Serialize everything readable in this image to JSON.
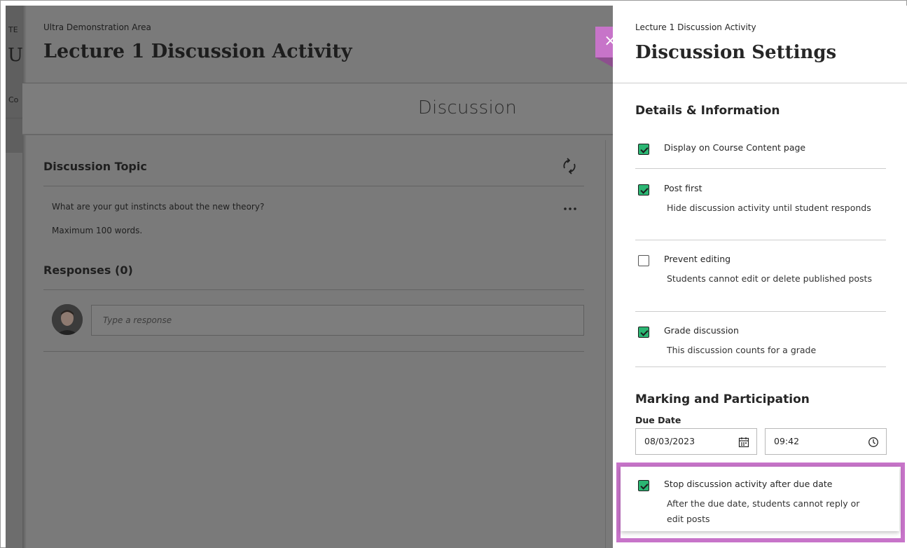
{
  "underlying_page": {
    "fragment_1": "TE",
    "fragment_2": "U",
    "fragment_3": "Co"
  },
  "background_panel": {
    "breadcrumb": "Ultra Demonstration Area",
    "title": "Lecture 1 Discussion Activity",
    "tab_label": "Discussion",
    "topic_heading": "Discussion Topic",
    "topic_question": "What are your gut instincts about the new theory?",
    "topic_note": "Maximum 100 words.",
    "responses_heading": "Responses (0)",
    "response_placeholder": "Type a response"
  },
  "close_button": {
    "glyph": "×"
  },
  "settings_panel": {
    "breadcrumb": "Lecture 1 Discussion Activity",
    "title": "Discussion Settings",
    "details_heading": "Details & Information",
    "settings": [
      {
        "label": "Display on Course Content page",
        "description": "",
        "checked": true
      },
      {
        "label": "Post first",
        "description": "Hide discussion activity until student responds",
        "checked": true
      },
      {
        "label": "Prevent editing",
        "description": "Students cannot edit or delete published posts",
        "checked": false
      },
      {
        "label": "Grade discussion",
        "description": "This discussion counts for a grade",
        "checked": true
      }
    ],
    "marking_heading": "Marking and Participation",
    "due_date_label": "Due Date",
    "due_date_value": "08/03/2023",
    "due_time_value": "09:42",
    "stop_activity": {
      "label": "Stop discussion activity after due date",
      "description": "After the due date, students cannot reply or edit posts",
      "checked": true
    }
  },
  "colors": {
    "accent_purple": "#c774c9",
    "checkbox_green": "#2bb673",
    "overlay_gray": "#7a7a7a"
  },
  "icons": {
    "refresh": "refresh-icon",
    "more": "more-options-icon",
    "calendar": "calendar-icon",
    "clock": "clock-icon",
    "close": "close-icon",
    "checkbox_checked": "checkbox-checked-icon",
    "checkbox_unchecked": "checkbox-unchecked-icon"
  }
}
